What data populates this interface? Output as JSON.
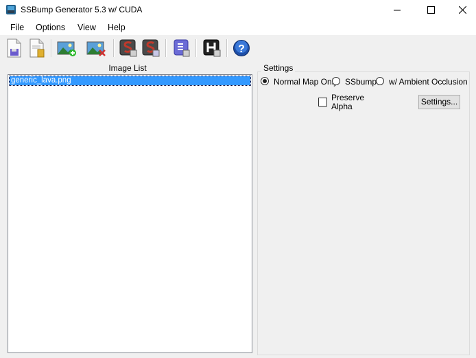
{
  "window": {
    "title": "SSBump Generator 5.3 w/ CUDA",
    "icon": "ssbump-app-icon",
    "controls": [
      "minimize-icon",
      "maximize-icon",
      "close-icon"
    ]
  },
  "menu": {
    "items": [
      "File",
      "Options",
      "View",
      "Help"
    ]
  },
  "toolbar": {
    "buttons": [
      {
        "icon": "new-project-icon"
      },
      {
        "icon": "open-project-icon"
      },
      {
        "icon": "add-image-icon"
      },
      {
        "icon": "remove-image-icon"
      },
      {
        "icon": "generate-ssbump-icon"
      },
      {
        "icon": "generate-ssbump-batch-icon"
      },
      {
        "icon": "export-icon"
      },
      {
        "icon": "heightmap-icon"
      },
      {
        "icon": "help-icon"
      }
    ]
  },
  "image_list": {
    "label": "Image List",
    "items": [
      "generic_lava.png"
    ],
    "selected_index": 0
  },
  "settings": {
    "group_title": "Settings",
    "radio_options": [
      "Normal Map Only",
      "SSbump",
      "w/ Ambient Occlusion"
    ],
    "selected_option": "Normal Map Only",
    "preserve_alpha": {
      "label_line1": "Preserve",
      "label_line2": "Alpha",
      "checked": false
    },
    "settings_button": "Settings..."
  },
  "colors": {
    "selection": "#3399ff",
    "window_bg": "#f0f0f0"
  }
}
